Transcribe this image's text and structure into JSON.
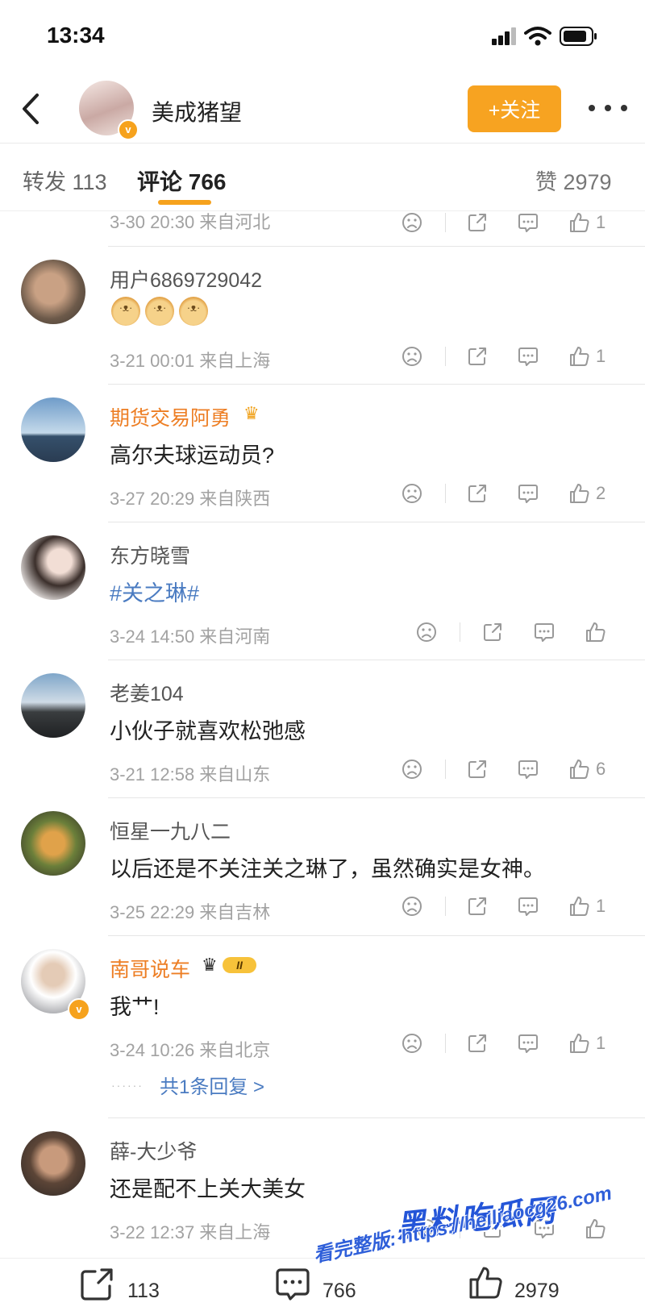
{
  "status_bar": {
    "time": "13:34"
  },
  "header": {
    "author_name": "美成猪望",
    "follow_label": "+关注",
    "vbadge": "v"
  },
  "tabs": {
    "repost": "转发 113",
    "comments": "评论 766",
    "likes": "赞 2979"
  },
  "partial_row": {
    "meta": "3-30 20:30 来自河北",
    "likes": "1"
  },
  "comments": [
    {
      "user": "用户6869729042",
      "text": "",
      "emojis": [
        "doge",
        "doge",
        "doge"
      ],
      "meta": "3-21 00:01 来自上海",
      "likes": "1"
    },
    {
      "user": "期货交易阿勇",
      "text": "高尔夫球运动员?",
      "meta": "3-27 20:29 来自陕西",
      "likes": "2"
    },
    {
      "user": "东方晓雪",
      "text": "#关之琳#",
      "meta": "3-24 14:50 来自河南",
      "likes": ""
    },
    {
      "user": "老姜104",
      "text": "小伙子就喜欢松弛感",
      "meta": "3-21 12:58 来自山东",
      "likes": "6"
    },
    {
      "user": "恒星一九八二",
      "text": "以后还是不关注关之琳了，虽然确实是女神。",
      "meta": "3-25 22:29 来自吉林",
      "likes": "1"
    },
    {
      "user": "南哥说车",
      "text": "我艹!",
      "meta": "3-24 10:26 来自北京",
      "likes": "1",
      "replies": "共1条回复 >",
      "vip_level": "II"
    },
    {
      "user": "薛-大少爷",
      "text": "还是配不上关大美女",
      "meta": "3-22 12:37 来自上海",
      "likes": ""
    }
  ],
  "bottom_bar": {
    "reposts": "113",
    "comments": "766",
    "likes": "2979"
  },
  "watermark": {
    "brand": "黑料吃瓜网",
    "url": "看完整版: https://heiliaocg26.com"
  },
  "colors": {
    "accent": "#f6a21d",
    "vip_name": "#ed7e24",
    "topic": "#4a7bc1",
    "watermark": "#2455d8"
  }
}
